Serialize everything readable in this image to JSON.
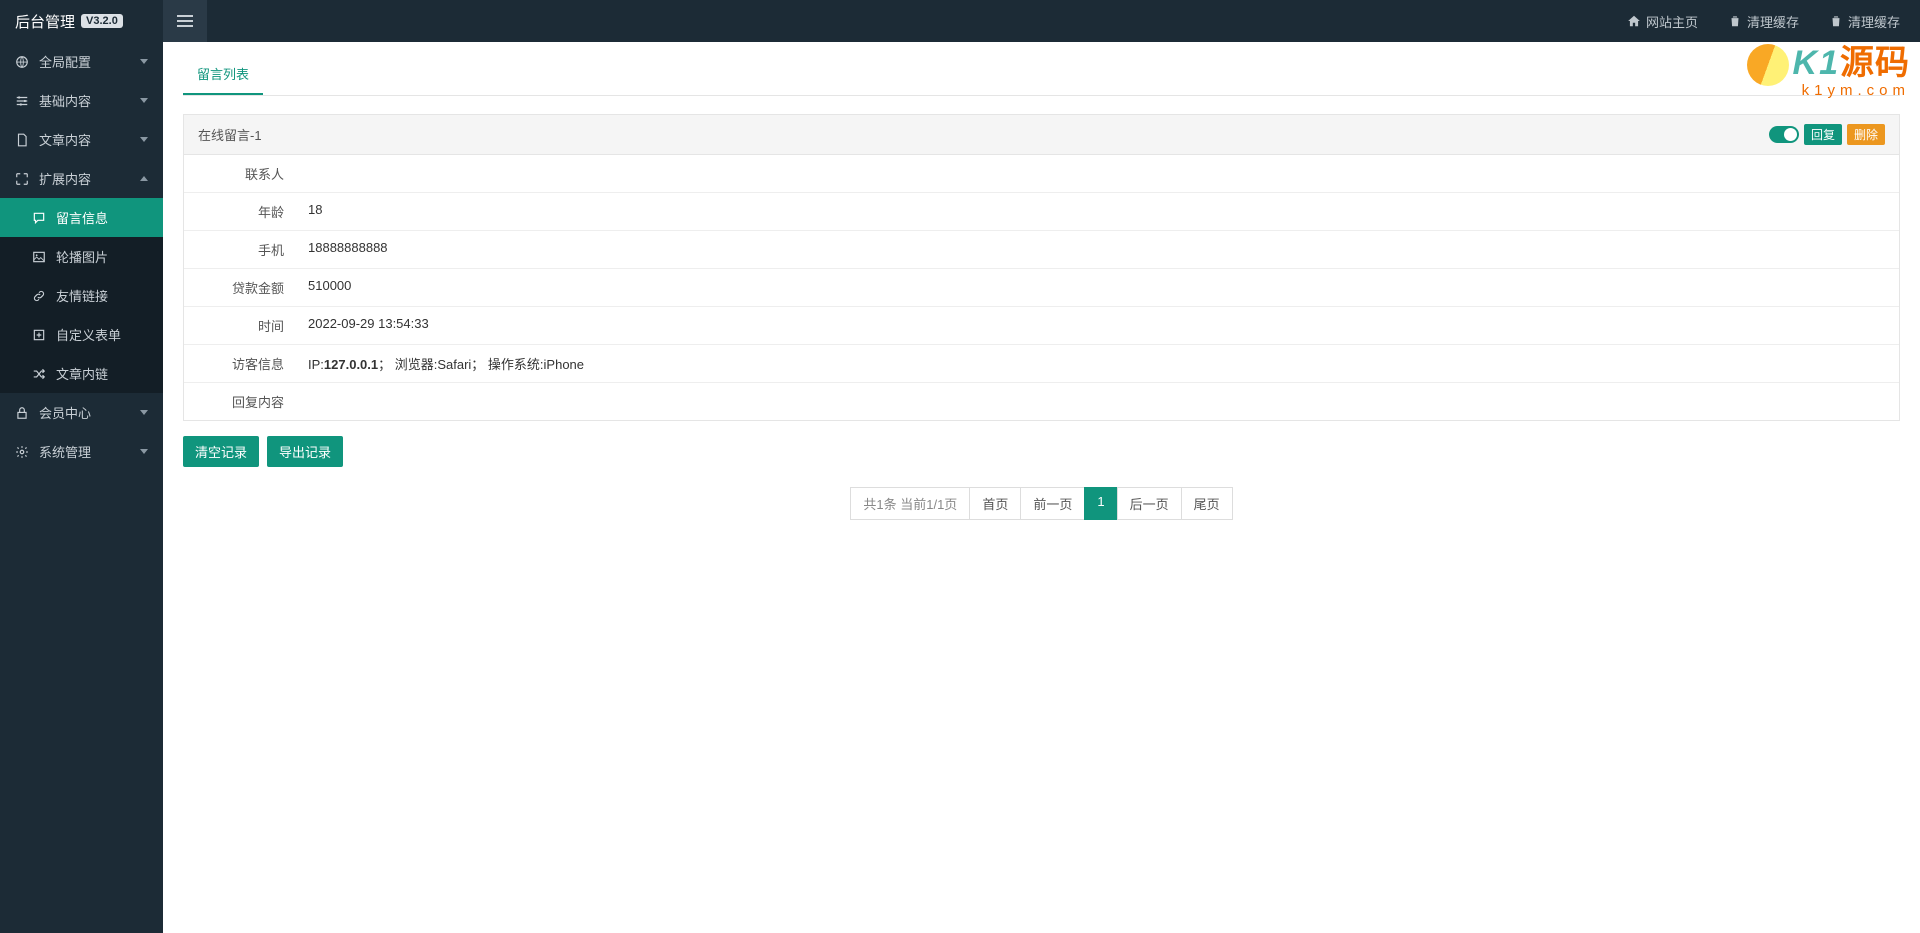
{
  "header": {
    "brand_title": "后台管理",
    "brand_version": "V3.2.0",
    "links": {
      "home": "网站主页",
      "clear_cache": "清理缓存",
      "clear_cache2": "清理缓存"
    }
  },
  "sidebar": {
    "items": [
      {
        "label": "全局配置",
        "has_chevron": true
      },
      {
        "label": "基础内容",
        "has_chevron": true
      },
      {
        "label": "文章内容",
        "has_chevron": true
      },
      {
        "label": "扩展内容",
        "has_chevron": true,
        "expanded": true,
        "children": [
          {
            "label": "留言信息",
            "active": true
          },
          {
            "label": "轮播图片"
          },
          {
            "label": "友情链接"
          },
          {
            "label": "自定义表单"
          },
          {
            "label": "文章内链"
          }
        ]
      },
      {
        "label": "会员中心",
        "has_chevron": true
      },
      {
        "label": "系统管理",
        "has_chevron": true
      }
    ]
  },
  "tab": {
    "label": "留言列表"
  },
  "record": {
    "title": "在线留言-1",
    "btn_reply": "回复",
    "btn_delete": "删除",
    "rows": [
      {
        "label": "联系人",
        "value": ""
      },
      {
        "label": "年龄",
        "value": "18"
      },
      {
        "label": "手机",
        "value": "18888888888"
      },
      {
        "label": "贷款金额",
        "value": "510000"
      },
      {
        "label": "时间",
        "value": "2022-09-29 13:54:33"
      },
      {
        "label": "访客信息",
        "value_ip": "127.0.0.1",
        "value_rest": "；  浏览器:Safari；  操作系统:iPhone"
      },
      {
        "label": "回复内容",
        "value": ""
      }
    ]
  },
  "actions": {
    "clear": "清空记录",
    "export": "导出记录"
  },
  "pagination": {
    "info": "共1条 当前1/1页",
    "first": "首页",
    "prev": "前一页",
    "current": "1",
    "next": "后一页",
    "last": "尾页"
  },
  "watermark": {
    "k1": "K1",
    "ym": "源码",
    "url": "k1ym.com"
  }
}
